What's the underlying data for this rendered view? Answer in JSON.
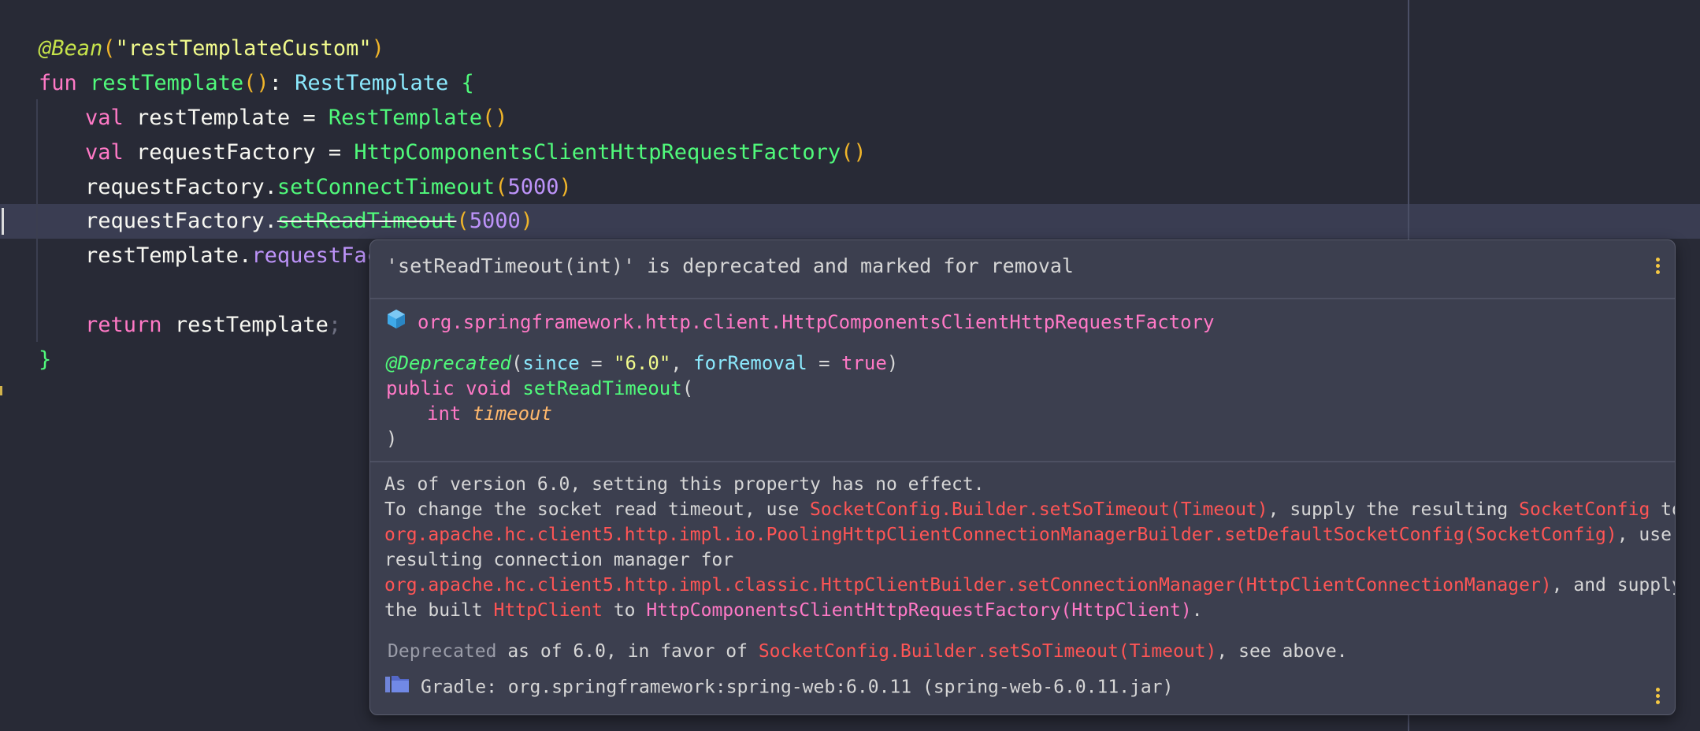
{
  "editor": {
    "lines": {
      "l1": {
        "annotation": "@Bean",
        "open": "(",
        "string": "\"restTemplateCustom\"",
        "close": ")"
      },
      "l2": {
        "kw": "fun",
        "name": "restTemplate",
        "parens": "()",
        "colon": ": ",
        "type": "RestTemplate",
        "brace": "{"
      },
      "l3": {
        "kw": "val",
        "name": "restTemplate",
        "eq": " = ",
        "ctor": "RestTemplate",
        "parens": "()"
      },
      "l4": {
        "kw": "val",
        "name": "requestFactory",
        "eq": " = ",
        "ctor": "HttpComponentsClientHttpRequestFactory",
        "parens": "()"
      },
      "l5": {
        "obj": "requestFactory.",
        "method": "setConnectTimeout",
        "open": "(",
        "num": "5000",
        "close": ")"
      },
      "l6": {
        "obj": "requestFactory.",
        "method": "setReadTimeout",
        "open": "(",
        "num": "5000",
        "close": ")"
      },
      "l7": {
        "obj": "restTemplate.",
        "prop": "requestFact"
      },
      "l9": {
        "kw": "return",
        "name": "restTemplate",
        "semi": ";"
      },
      "l10": {
        "brace": "}"
      }
    }
  },
  "popup": {
    "title": "'setReadTimeout(int)' is deprecated and marked for removal",
    "class_name": "org.springframework.http.client.HttpComponentsClientHttpRequestFactory",
    "class_icon": "class-cube-icon",
    "signature": {
      "annotation": "@Deprecated",
      "open": "(",
      "since_key": "since",
      "eq1": " = ",
      "since_val": "\"6.0\"",
      "comma": ", ",
      "removal_key": "forRemoval",
      "eq2": " = ",
      "removal_val": "true",
      "close": ")",
      "mods": "public void ",
      "method": "setReadTimeout",
      "method_open": "(",
      "ptype": "int",
      "pname": "timeout",
      "end": ")"
    },
    "description": {
      "l1": "As of version 6.0, setting this property has no effect.",
      "l2a": "To change the socket read timeout, use ",
      "l2b": "SocketConfig.Builder.setSoTimeout(Timeout)",
      "l2c": ", supply the resulting ",
      "l2d": "SocketConfig",
      "l2e": " to",
      "l3a": "org.apache.hc.client5.http.impl.io.PoolingHttpClientConnectionManagerBuilder.setDefaultSocketConfig(SocketConfig)",
      "l3b": ", use the",
      "l4": "resulting connection manager for",
      "l5a": "org.apache.hc.client5.http.impl.classic.HttpClientBuilder.setConnectionManager(HttpClientConnectionManager)",
      "l5b": ", and supply",
      "l6a": "the built ",
      "l6b": "HttpClient",
      "l6c": " to ",
      "l6d": "HttpComponentsClientHttpRequestFactory(HttpClient)",
      "l6e": "."
    },
    "deprecated": {
      "label": "Deprecated",
      "text1": " as of 6.0, in favor of ",
      "link": "SocketConfig.Builder.setSoTimeout(Timeout)",
      "text2": ", see above."
    },
    "gradle": "Gradle: org.springframework:spring-web:6.0.11 (spring-web-6.0.11.jar)",
    "gradle_icon": "library-folder-icon"
  },
  "colors": {
    "background": "#282a36",
    "popup_background": "#3c3f4f",
    "keyword": "#ff79c6",
    "function": "#50fa7b",
    "type": "#8be9fd",
    "number": "#bd93f9",
    "string": "#f1fa8c",
    "link": "#ff5555"
  }
}
